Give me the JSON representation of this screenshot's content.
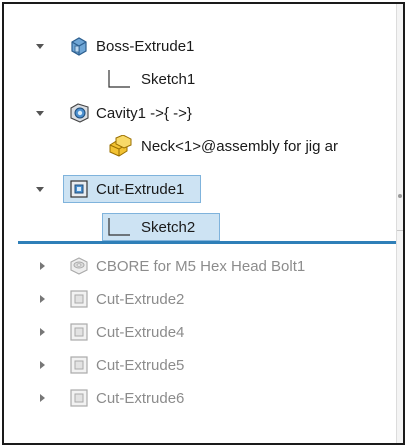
{
  "feature_tree": {
    "items": [
      {
        "label": "Boss-Extrude1",
        "icon": "boss-extrude-icon",
        "state": "expanded"
      },
      {
        "label": "Sketch1",
        "icon": "sketch-icon",
        "state": "leaf"
      },
      {
        "label": "Cavity1 ->{ ->}",
        "icon": "cavity-icon",
        "state": "expanded"
      },
      {
        "label": "Neck<1>@assembly for jig ar",
        "icon": "component-icon",
        "state": "leaf"
      },
      {
        "label": "Cut-Extrude1",
        "icon": "cut-extrude-icon",
        "state": "expanded",
        "selected": true
      },
      {
        "label": "Sketch2",
        "icon": "sketch-icon",
        "state": "leaf",
        "selected": true
      },
      {
        "label": "CBORE for M5 Hex Head Bolt1",
        "icon": "hole-wizard-icon",
        "state": "collapsed",
        "suppressed": true
      },
      {
        "label": "Cut-Extrude2",
        "icon": "cut-extrude-icon",
        "state": "collapsed",
        "suppressed": true
      },
      {
        "label": "Cut-Extrude4",
        "icon": "cut-extrude-icon",
        "state": "collapsed",
        "suppressed": true
      },
      {
        "label": "Cut-Extrude5",
        "icon": "cut-extrude-icon",
        "state": "collapsed",
        "suppressed": true
      },
      {
        "label": "Cut-Extrude6",
        "icon": "cut-extrude-icon",
        "state": "collapsed",
        "suppressed": true
      }
    ],
    "rollback_bar": "rollback-bar"
  },
  "colors": {
    "selection_fill": "#cde3f3",
    "selection_border": "#7fb3dc",
    "rollback_bar": "#2f7fb8",
    "suppressed_text": "#8c8c8c"
  }
}
